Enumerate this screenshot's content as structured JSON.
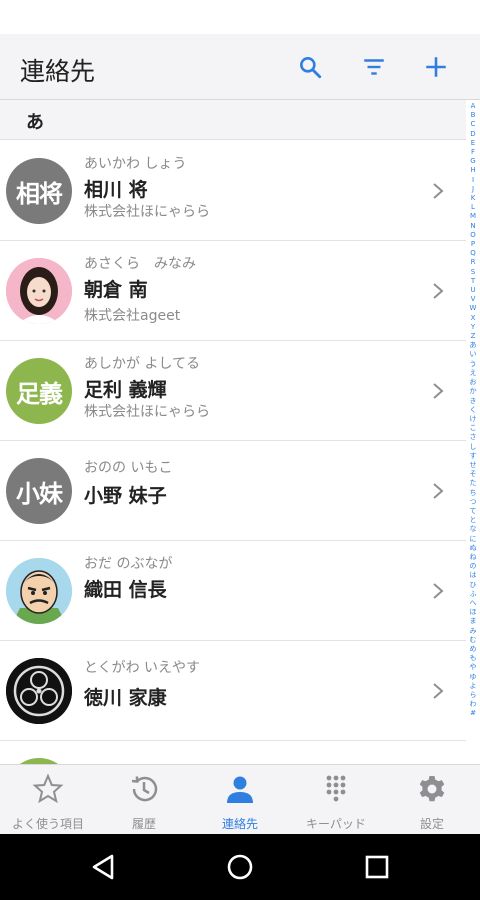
{
  "header": {
    "title": "連絡先",
    "search_icon": "search-icon",
    "filter_icon": "filter-icon",
    "add_icon": "plus-icon",
    "accent": "#2f7fe0"
  },
  "section": {
    "label": "あ"
  },
  "contacts": [
    {
      "kana": "あいかわ しょう",
      "name": "相川 将",
      "company": "株式会社ほにゃらら",
      "avatar_text": "相将",
      "avatar_type": "initials",
      "avatar_color": "#7a7a7a"
    },
    {
      "kana": "あさくら　みなみ",
      "name": "朝倉 南",
      "company": "株式会社ageet",
      "avatar_text": "",
      "avatar_type": "photo-woman",
      "avatar_color": "#f0a0b8"
    },
    {
      "kana": "あしかが よしてる",
      "name": "足利 義輝",
      "company": "株式会社ほにゃらら",
      "avatar_text": "足義",
      "avatar_type": "initials",
      "avatar_color": "#8db64e"
    },
    {
      "kana": "おのの いもこ",
      "name": "小野 妹子",
      "company": "",
      "avatar_text": "小妹",
      "avatar_type": "initials",
      "avatar_color": "#7a7a7a"
    },
    {
      "kana": "おだ のぶなが",
      "name": "織田 信長",
      "company": "",
      "avatar_text": "",
      "avatar_type": "illustration-samurai",
      "avatar_color": "#9ed0e8"
    },
    {
      "kana": "とくがわ いえやす",
      "name": "徳川 家康",
      "company": "",
      "avatar_text": "",
      "avatar_type": "crest",
      "avatar_color": "#111111"
    }
  ],
  "index_letters": [
    "A",
    "B",
    "C",
    "D",
    "E",
    "F",
    "G",
    "H",
    "I",
    "J",
    "K",
    "L",
    "M",
    "N",
    "O",
    "P",
    "Q",
    "R",
    "S",
    "T",
    "U",
    "V",
    "W",
    "X",
    "Y",
    "Z",
    "あ",
    "い",
    "う",
    "え",
    "お",
    "か",
    "き",
    "く",
    "け",
    "こ",
    "さ",
    "し",
    "す",
    "せ",
    "そ",
    "た",
    "ち",
    "つ",
    "て",
    "と",
    "な",
    "に",
    "ぬ",
    "ね",
    "の",
    "は",
    "ひ",
    "ふ",
    "へ",
    "ほ",
    "ま",
    "み",
    "む",
    "め",
    "も",
    "や",
    "ゆ",
    "よ",
    "ら",
    "わ",
    "#"
  ],
  "tabs": [
    {
      "label": "よく使う項目",
      "icon": "star-icon",
      "active": false
    },
    {
      "label": "履歴",
      "icon": "history-icon",
      "active": false
    },
    {
      "label": "連絡先",
      "icon": "person-icon",
      "active": true
    },
    {
      "label": "キーパッド",
      "icon": "keypad-icon",
      "active": false
    },
    {
      "label": "設定",
      "icon": "gear-icon",
      "active": false
    }
  ],
  "nav": {
    "back_icon": "back-triangle-icon",
    "home_icon": "home-circle-icon",
    "recents_icon": "recents-square-icon"
  }
}
